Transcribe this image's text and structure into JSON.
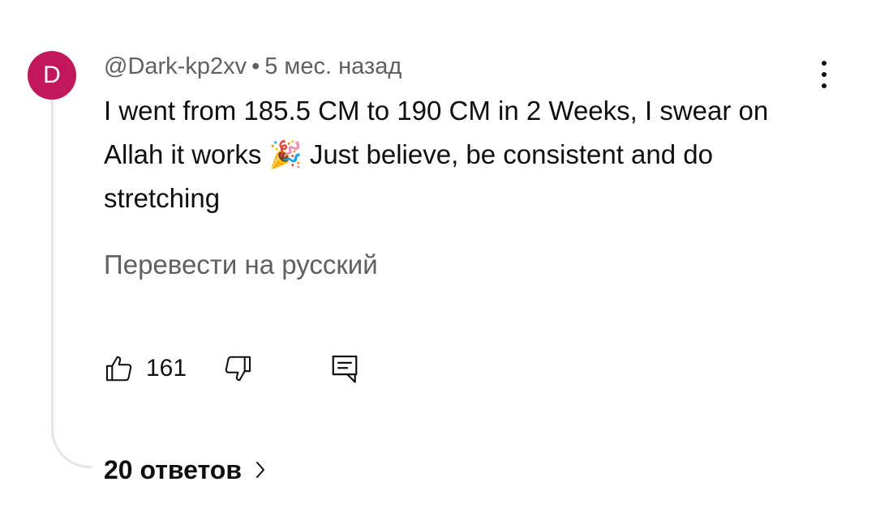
{
  "comment": {
    "avatar_letter": "D",
    "avatar_color": "#c2185b",
    "author": "@Dark-kp2xv",
    "separator": "•",
    "timestamp": "5 мес. назад",
    "text_part1": "I went from 185.5 CM to 190 CM in 2 Weeks, I swear on Allah it works ",
    "emoji": "🎉",
    "text_part2": " Just believe, be consistent and do stretching",
    "translate_label": "Перевести на русский",
    "like_count": "161",
    "replies_label": "20 ответов"
  },
  "icons": {
    "more": "more-vert-icon",
    "like": "thumb-up-icon",
    "dislike": "thumb-down-icon",
    "reply": "comment-reply-icon",
    "replies_arrow": "chevron-right-icon"
  },
  "colors": {
    "primary_text": "#0f0f0f",
    "secondary_text": "#606060",
    "thread_line": "#e5e5e5"
  }
}
